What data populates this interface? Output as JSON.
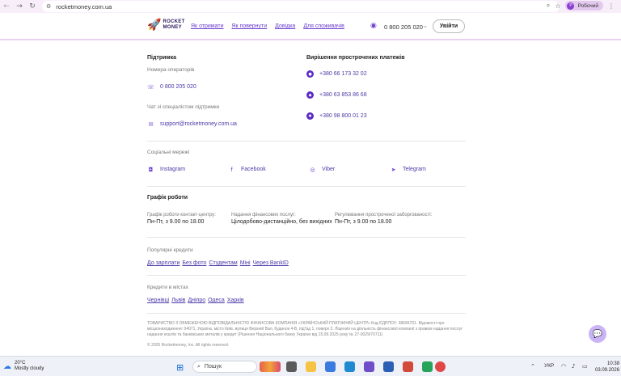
{
  "browser": {
    "url": "rocketmoney.com.ua",
    "profile_initial": "Р",
    "profile_label": "Робочий"
  },
  "header": {
    "logo_line1": "ROCKET",
    "logo_line2": "MONEY",
    "menu": [
      "Як отримати",
      "Як повернути",
      "Довідка",
      "Для споживачів"
    ],
    "phone": "0 800 205 020",
    "login": "Увійти"
  },
  "support": {
    "title": "Підтримка",
    "operators_label": "Номера операторів",
    "phone": "0 800 205 020",
    "chat_label": "Чат зі спеціалістом підтримки",
    "email": "support@rocketmoney.com.ua"
  },
  "overdue": {
    "title": "Вирішення прострочених платежів",
    "phones": [
      "+380 66 173 32 02",
      "+380 63 853 86 68",
      "+380 98 800 01 23"
    ]
  },
  "social": {
    "title": "Соціальні мережі",
    "items": [
      "Instagram",
      "Facebook",
      "Viber",
      "Telegram"
    ]
  },
  "schedule": {
    "title": "Графік роботи",
    "cols": [
      {
        "label": "Графік роботи контакт-центру:",
        "value": "Пн-Пт, з 9.00 по 18.00"
      },
      {
        "label": "Надання фінансових послуг:",
        "value": "Цілодобово-дистанційно, без вихідних"
      },
      {
        "label": "Регулювання простроченої заборгованості:",
        "value": "Пн-Пт, з 9.00 по 18.00"
      }
    ]
  },
  "popular": {
    "title": "Популярні кредити",
    "links": [
      "До зарплати",
      "Без фото",
      "Студентам",
      "Міні",
      "Через BankID"
    ]
  },
  "cities": {
    "title": "Кредити в містах",
    "links": [
      "Чернівці",
      "Львів",
      "Дніпро",
      "Одеса",
      "Харків"
    ]
  },
  "legal": {
    "text": "ТОВАРИСТВО З ОБМЕЖЕНОЮ ВІДПОВІДАЛЬНІСТЮ ФІНАНСОВА КОМПАНІЯ «УКРАЇНСЬКИЙ ПЛАТІЖНИЙ ЦЕНТР» Код ЄДРПОУ: 38696701. Відомості про місцезнаходження: 04071, Україна, місто Київ, вулиця Верхній Вал, будинок 4-В, під'їзд 1, поверх 2. Ліцензія на діяльність фінансової компанії з правом надання послуг надання коштів та банківських металів у кредит (Рішення Національного банку України від 15.09.2025 року № 27-0029/70711)",
    "copyright": "© 2026 Rocketmoney, Inc. All rights reserved."
  },
  "taskbar": {
    "temp": "20°C",
    "weather": "Mostly cloudy",
    "search": "Пошук",
    "lang": "УКР",
    "time": "10:38",
    "date": "03.09.2026"
  }
}
